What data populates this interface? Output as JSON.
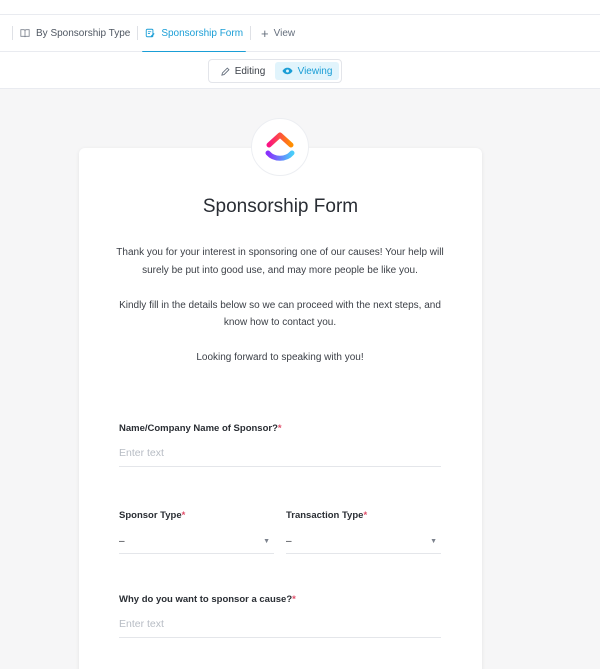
{
  "tabs": [
    {
      "label": "By Sponsorship Type",
      "icon": "book-icon",
      "active": false
    },
    {
      "label": "Sponsorship Form",
      "icon": "form-icon",
      "active": true
    }
  ],
  "add_view_label": "View",
  "mode_toggle": {
    "editing_label": "Editing",
    "viewing_label": "Viewing",
    "active": "viewing"
  },
  "colors": {
    "accent": "#1a9ed6",
    "required": "#e04f6a",
    "logo_gradient": [
      "#fa1283",
      "#ff8e00",
      "#8930fd",
      "#49ccf9"
    ]
  },
  "form": {
    "title": "Sponsorship Form",
    "description": [
      "Thank you for your interest in sponsoring one of our causes! Your help will surely be put into good use, and may more people be like you.",
      "Kindly fill in the details below so we can proceed with the next steps, and know how to contact you.",
      "Looking forward to speaking with you!"
    ],
    "fields": {
      "sponsor_name": {
        "label": "Name/Company Name of Sponsor?",
        "required_mark": "*",
        "placeholder": "Enter text"
      },
      "sponsor_type": {
        "label": "Sponsor Type",
        "required_mark": "*",
        "value": "–"
      },
      "transaction_type": {
        "label": "Transaction Type",
        "required_mark": "*",
        "value": "–"
      },
      "reason": {
        "label": "Why do you want to sponsor a cause?",
        "required_mark": "*",
        "placeholder": "Enter text"
      }
    }
  }
}
